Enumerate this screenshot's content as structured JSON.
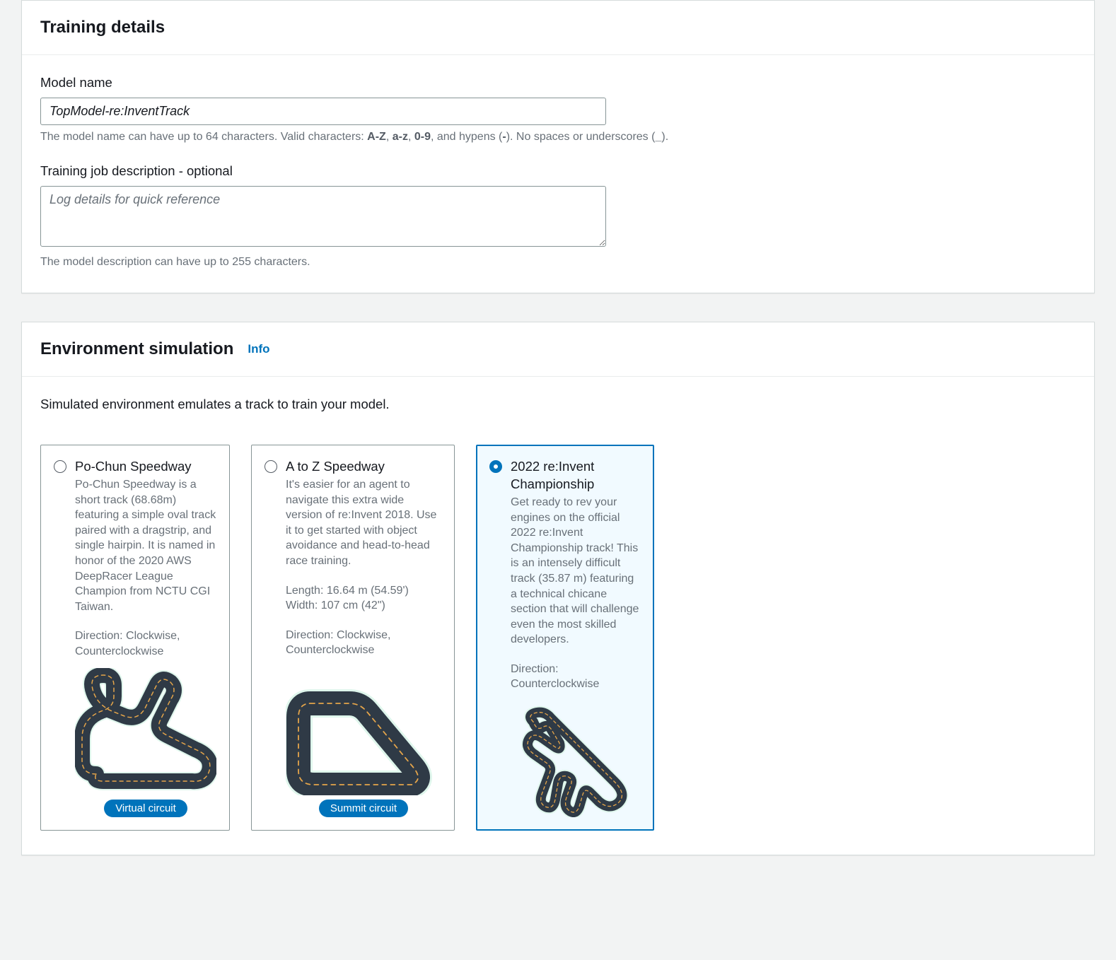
{
  "training_details": {
    "heading": "Training details",
    "model_name_label": "Model name",
    "model_name_value": "TopModel-re:InventTrack",
    "model_name_hint_pre": "The model name can have up to 64 characters. Valid characters: ",
    "model_name_hint_b1": "A-Z",
    "model_name_hint_sep1": ", ",
    "model_name_hint_b2": "a-z",
    "model_name_hint_sep2": ", ",
    "model_name_hint_b3": "0-9",
    "model_name_hint_sep3": ", and hypens (",
    "model_name_hint_b4": "-",
    "model_name_hint_sep4": "). No spaces or underscores (",
    "model_name_hint_b5": "_",
    "model_name_hint_sep5": ").",
    "desc_label": "Training job description - optional",
    "desc_placeholder": "Log details for quick reference",
    "desc_hint": "The model description can have up to 255 characters."
  },
  "environment": {
    "heading": "Environment simulation",
    "info_label": "Info",
    "intro": "Simulated environment emulates a track to train your model.",
    "tracks": [
      {
        "title": "Po-Chun Speedway",
        "desc": "Po-Chun Speedway is a short track (68.68m) featuring a simple oval track paired with a dragstrip, and single hairpin. It is named in honor of the 2020 AWS DeepRacer League Champion from NCTU CGI Taiwan.",
        "meta": "",
        "direction": "Direction: Clockwise, Counterclockwise",
        "badge": "Virtual circuit",
        "selected": false
      },
      {
        "title": "A to Z Speedway",
        "desc": "It's easier for an agent to navigate this extra wide version of re:Invent 2018. Use it to get started with object avoidance and head-to-head race training.",
        "meta": "Length: 16.64 m (54.59')\nWidth: 107 cm (42\")",
        "direction": "Direction: Clockwise, Counterclockwise",
        "badge": "Summit circuit",
        "selected": false
      },
      {
        "title": "2022 re:Invent Championship",
        "desc": "Get ready to rev your engines on the official 2022 re:Invent Championship track! This is an intensely difficult track (35.87 m) featuring a technical chicane section that will challenge even the most skilled developers.",
        "meta": "",
        "direction": "Direction: Counterclockwise",
        "badge": "",
        "selected": true
      }
    ]
  }
}
